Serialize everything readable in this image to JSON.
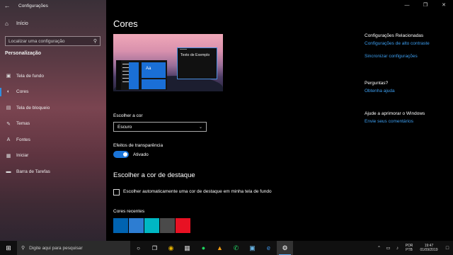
{
  "window": {
    "title": "Configurações",
    "back_icon": "arrow-left-icon"
  },
  "sidebar": {
    "home_label": "Início",
    "search_placeholder": "Localizar uma configuração",
    "section_label": "Personalização",
    "items": [
      {
        "label": "Tela de fundo",
        "icon": "picture-icon",
        "active": false
      },
      {
        "label": "Cores",
        "icon": "palette-icon",
        "active": true
      },
      {
        "label": "Tela de bloqueio",
        "icon": "lock-screen-icon",
        "active": false
      },
      {
        "label": "Temas",
        "icon": "brush-icon",
        "active": false
      },
      {
        "label": "Fontes",
        "icon": "font-icon",
        "active": false
      },
      {
        "label": "Iniciar",
        "icon": "start-menu-icon",
        "active": false
      },
      {
        "label": "Barra de Tarefas",
        "icon": "taskbar-icon",
        "active": false
      }
    ]
  },
  "main": {
    "title": "Cores",
    "preview_text": "Texto de Exemplo",
    "preview_tile_label": "Aa",
    "choose_color_label": "Escolher a cor",
    "choose_color_value": "Escuro",
    "transparency_label": "Efeitos de transparência",
    "transparency_state": "Ativado",
    "transparency_on": true,
    "accent_title": "Escolher a cor de destaque",
    "auto_accent_label": "Escolher automaticamente uma cor de destaque em minha tela de fundo",
    "auto_accent_checked": false,
    "recent_colors_label": "Cores recentes",
    "recent_colors": [
      "#0063b1",
      "#2d7dd2",
      "#00b7c3",
      "#4a4a4a",
      "#e81123"
    ]
  },
  "related": {
    "heading": "Configurações Relacionadas",
    "links": [
      "Configurações de alto contraste",
      "Sincronizar configurações"
    ],
    "questions_heading": "Perguntas?",
    "questions_link": "Obtenha ajuda",
    "improve_heading": "Ajude a aprimorar o Windows",
    "improve_link": "Envie seus comentários"
  },
  "taskbar": {
    "search_placeholder": "Digite aqui para pesquisar",
    "apps": [
      "cortana-icon",
      "task-view-icon",
      "chrome-icon",
      "calculator-icon",
      "spotify-icon",
      "media-player-icon",
      "whatsapp-icon",
      "notes-icon",
      "edge-icon",
      "settings-icon"
    ],
    "lang_line1": "POR",
    "lang_line2": "PTB",
    "time": "19:47",
    "date": "01/09/2019"
  },
  "colors": {
    "accent": "#1a74d8",
    "link": "#3c9ef0"
  }
}
